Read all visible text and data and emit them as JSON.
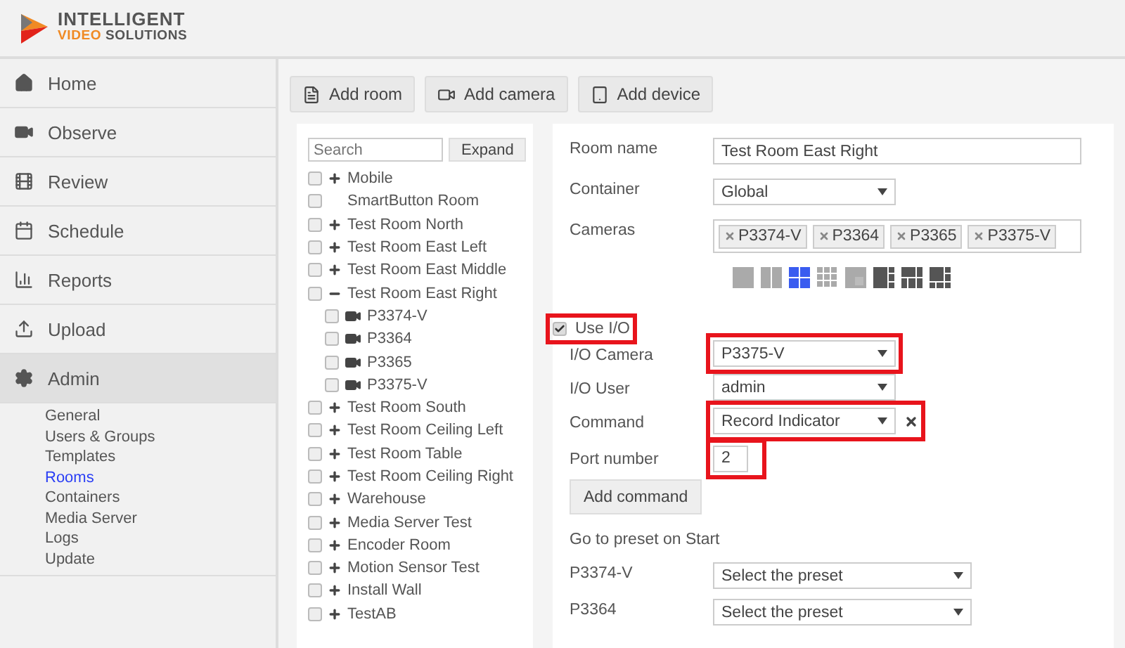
{
  "logo": {
    "line1": "INTELLIGENT",
    "accent": "VIDEO",
    "line2": "SOLUTIONS"
  },
  "nav": [
    {
      "label": "Home",
      "selected": false
    },
    {
      "label": "Observe",
      "selected": false
    },
    {
      "label": "Review",
      "selected": false
    },
    {
      "label": "Schedule",
      "selected": false
    },
    {
      "label": "Reports",
      "selected": false
    },
    {
      "label": "Upload",
      "selected": false
    },
    {
      "label": "Admin",
      "selected": true,
      "children": [
        {
          "label": "General",
          "selected": false
        },
        {
          "label": "Users & Groups",
          "selected": false
        },
        {
          "label": "Templates",
          "selected": false
        },
        {
          "label": "Rooms",
          "selected": true
        },
        {
          "label": "Containers",
          "selected": false
        },
        {
          "label": "Media Server",
          "selected": false
        },
        {
          "label": "Logs",
          "selected": false
        },
        {
          "label": "Update",
          "selected": false
        }
      ]
    }
  ],
  "toolbar": [
    {
      "kind": "room",
      "label": "Add room"
    },
    {
      "kind": "camera",
      "label": "Add camera"
    },
    {
      "kind": "device",
      "label": "Add device"
    }
  ],
  "tree": {
    "search": {
      "placeholder": "Search"
    },
    "expand_button": "Expand",
    "items": [
      {
        "kind": "room",
        "label": "Mobile",
        "checked": false,
        "expanded": false
      },
      {
        "kind": "plain",
        "label": "SmartButton Room",
        "checked": false
      },
      {
        "kind": "room",
        "label": "Test Room North",
        "checked": false,
        "expanded": false
      },
      {
        "kind": "room",
        "label": "Test Room East Left",
        "checked": false,
        "expanded": false
      },
      {
        "kind": "room",
        "label": "Test Room East Middle",
        "checked": false,
        "expanded": false
      },
      {
        "kind": "room",
        "label": "Test Room East Right",
        "checked": false,
        "expanded": true,
        "children": [
          {
            "kind": "camera",
            "label": "P3374-V",
            "checked": false
          },
          {
            "kind": "camera",
            "label": "P3364",
            "checked": false
          },
          {
            "kind": "camera",
            "label": "P3365",
            "checked": false
          },
          {
            "kind": "camera",
            "label": "P3375-V",
            "checked": false
          }
        ]
      },
      {
        "kind": "room",
        "label": "Test Room South",
        "checked": false,
        "expanded": false
      },
      {
        "kind": "room",
        "label": "Test Room Ceiling Left",
        "checked": false,
        "expanded": false
      },
      {
        "kind": "room",
        "label": "Test Room Table",
        "checked": false,
        "expanded": false
      },
      {
        "kind": "room",
        "label": "Test Room Ceiling Right",
        "checked": false,
        "expanded": false
      },
      {
        "kind": "room",
        "label": "Warehouse",
        "checked": false,
        "expanded": false
      },
      {
        "kind": "room",
        "label": "Media Server Test",
        "checked": false,
        "expanded": false
      },
      {
        "kind": "room",
        "label": "Encoder Room",
        "checked": false,
        "expanded": false
      },
      {
        "kind": "room",
        "label": "Motion Sensor Test",
        "checked": false,
        "expanded": false
      },
      {
        "kind": "room",
        "label": "Install Wall",
        "checked": false,
        "expanded": false
      },
      {
        "kind": "room",
        "label": "TestAB",
        "checked": false,
        "expanded": false
      }
    ]
  },
  "form": {
    "room_name": {
      "label": "Room name",
      "value": "Test Room East Right"
    },
    "container": {
      "label": "Container",
      "value": "Global"
    },
    "cameras": {
      "label": "Cameras",
      "tags": [
        "P3374-V",
        "P3364",
        "P3365",
        "P3375-V"
      ]
    },
    "layouts": [
      {
        "kind": "single",
        "selected": false
      },
      {
        "kind": "two",
        "selected": false
      },
      {
        "kind": "quad",
        "selected": true
      },
      {
        "kind": "nine",
        "selected": false
      },
      {
        "kind": "pip",
        "selected": false
      },
      {
        "kind": "big-left",
        "selected": false
      },
      {
        "kind": "big-top",
        "selected": false
      },
      {
        "kind": "big-corner",
        "selected": false
      }
    ],
    "use_io": {
      "label": "Use I/O",
      "checked": true,
      "highlighted": true
    },
    "io_camera": {
      "label": "I/O Camera",
      "value": "P3375-V",
      "highlighted": true
    },
    "io_user": {
      "label": "I/O User",
      "value": "admin",
      "highlighted": false
    },
    "command": {
      "label": "Command",
      "value": "Record Indicator",
      "highlighted": true
    },
    "port": {
      "label": "Port number",
      "value": "2",
      "highlighted": true
    },
    "add_command": "Add command",
    "preset": {
      "title": "Go to preset on Start",
      "rows": [
        {
          "label": "P3374-V",
          "value": "Select the preset"
        },
        {
          "label": "P3364",
          "value": "Select the preset"
        }
      ]
    }
  }
}
